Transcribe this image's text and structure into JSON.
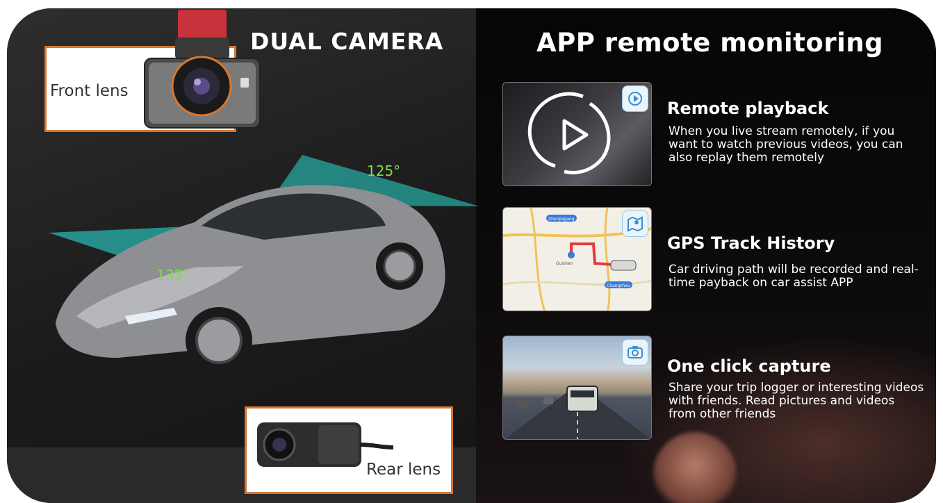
{
  "left_panel": {
    "title": "DUAL CAMERA",
    "front_label": "Front lens",
    "rear_label": "Rear lens",
    "angle_front": "125°",
    "angle_side": "135°",
    "fov_color": "#2ad9d0",
    "box_border_color": "#d8772f"
  },
  "right_panel": {
    "title": "APP remote monitoring",
    "features": [
      {
        "title": "Remote playback",
        "desc": "When you live stream remotely, if you want to watch previous videos, you can also replay them remotely",
        "icon": "play-rotate-icon"
      },
      {
        "title": "GPS Track History",
        "desc": "Car driving path will be recorded and real-time payback on car assist APP",
        "icon": "map-icon"
      },
      {
        "title": "One click capture",
        "desc": "Share your trip logger or interesting videos with friends. Read pictures and videos from other friends",
        "icon": "camera-icon"
      }
    ]
  },
  "map_labels": [
    "Zhenjiagang",
    "Changzhou",
    "Guishan"
  ]
}
